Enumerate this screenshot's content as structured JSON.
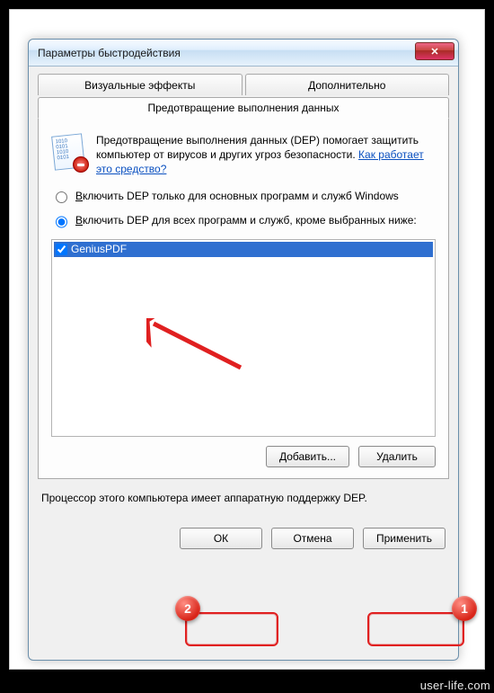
{
  "window": {
    "title": "Параметры быстродействия",
    "close_label": "✕"
  },
  "tabs": {
    "visual": "Визуальные эффекты",
    "advanced": "Дополнительно",
    "dep": "Предотвращение выполнения данных"
  },
  "dep_panel": {
    "info_lines": "1010 0101 1010 0101",
    "info_text_1": "Предотвращение выполнения данных (DEP) помогает защитить компьютер от вирусов и других угроз безопасности. ",
    "info_link": "Как работает это средство?",
    "radio1_pre": "В",
    "radio1": "ключить DEP только для основных программ и служб Windows",
    "radio2_pre": "В",
    "radio2": "ключить DEP для всех программ и служб, кроме выбранных ниже:",
    "list_item1": "GeniusPDF",
    "btn_add": "Добавить...",
    "btn_remove": "Удалить"
  },
  "footer_text": "Процессор этого компьютера имеет аппаратную поддержку DEP.",
  "actions": {
    "ok": "ОК",
    "cancel": "Отмена",
    "apply": "Применить"
  },
  "annotations": {
    "badge1": "1",
    "badge2": "2"
  },
  "watermark": "user-life.com"
}
